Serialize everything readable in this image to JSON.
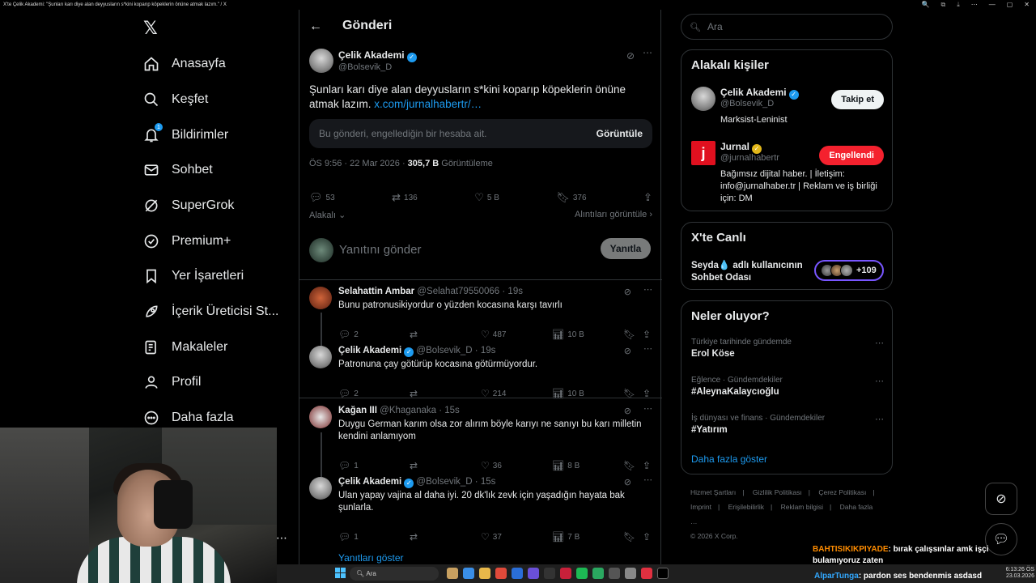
{
  "window": {
    "title": "X'te Çelik Akademi: \"Şunları karı diye alan deyyusların s*kini koparıp köpeklerin önüne atmak lazım.\" / X"
  },
  "nav": {
    "items": [
      {
        "label": "Anasayfa",
        "icon": "home-icon"
      },
      {
        "label": "Keşfet",
        "icon": "search-icon"
      },
      {
        "label": "Bildirimler",
        "icon": "bell-icon",
        "badge": "1"
      },
      {
        "label": "Sohbet",
        "icon": "mail-icon"
      },
      {
        "label": "SuperGrok",
        "icon": "grok-icon"
      },
      {
        "label": "Premium+",
        "icon": "verified-icon"
      },
      {
        "label": "Yer İşaretleri",
        "icon": "bookmark-icon"
      },
      {
        "label": "İçerik Üreticisi St...",
        "icon": "rocket-icon"
      },
      {
        "label": "Makaleler",
        "icon": "article-icon"
      },
      {
        "label": "Profil",
        "icon": "person-icon"
      },
      {
        "label": "Daha fazla",
        "icon": "more-circle-icon"
      }
    ]
  },
  "header": {
    "title": "Gönderi"
  },
  "post": {
    "author": "Çelik Akademi",
    "handle": "@Bolsevik_D",
    "text": "Şunları karı diye alan deyyusların s*kini koparıp köpeklerin önüne atmak lazım.",
    "link": "x.com/jurnalhabertr/…",
    "blocked_notice": "Bu gönderi, engellediğin bir hesaba ait.",
    "view_label": "Görüntüle",
    "time": "ÖS 9:56 · 22 Mar 2026 · ",
    "views": "305,7 B",
    "views_label": " Görüntüleme",
    "replies": "53",
    "reposts": "136",
    "likes": "5 B",
    "bookmarks": "376",
    "related_label": "Alakalı",
    "interactions_label": "Alıntıları görüntüle",
    "reply_placeholder": "Yanıtını gönder",
    "reply_button": "Yanıtla"
  },
  "replies": [
    {
      "name": "Selahattin Ambar",
      "handle": "@Selahat79550066 · 19s",
      "text": "Bunu patronusikiyordur o yüzden kocasına karşı tavırlı",
      "replies": "2",
      "likes": "487",
      "views": "10 B",
      "verified": false
    },
    {
      "name": "Çelik Akademi",
      "handle": "@Bolsevik_D · 19s",
      "text": "Patronuna çay götürüp kocasına götürmüyordur.",
      "replies": "2",
      "likes": "214",
      "views": "10 B",
      "verified": true
    },
    {
      "name": "Kağan III",
      "handle": "@Khaganaka · 15s",
      "text": "Duygu German karım olsa zor alırım böyle karıyı ne sanıyı bu karı milletin kendini anlamıyom",
      "replies": "1",
      "likes": "36",
      "views": "8 B",
      "verified": false
    },
    {
      "name": "Çelik Akademi",
      "handle": "@Bolsevik_D · 15s",
      "text": "Ulan yapay vajina al daha iyi. 20 dk'lık zevk için yaşadığın hayata bak şunlarla.",
      "replies": "1",
      "likes": "37",
      "views": "7 B",
      "verified": true
    }
  ],
  "show_replies": "Yanıtları göster",
  "search": {
    "placeholder": "Ara"
  },
  "related_people": {
    "title": "Alakalı kişiler",
    "people": [
      {
        "name": "Çelik Akademi",
        "handle": "@Bolsevik_D",
        "bio": "Marksist-Leninist",
        "button": "Takip et"
      },
      {
        "name": "Jurnal",
        "handle": "@jurnalhabertr",
        "bio": "Bağımsız dijital haber. | İletişim: info@jurnalhaber.tr | Reklam ve iş birliği için: DM",
        "button": "Engellendi",
        "logo_letter": "j"
      }
    ]
  },
  "live": {
    "title": "X'te Canlı",
    "text_line1": "Seyda💧 adlı kullanıcının",
    "text_line2": "Sohbet Odası",
    "count": "+109"
  },
  "trends": {
    "title": "Neler oluyor?",
    "items": [
      {
        "context": "Türkiye tarihinde gündemde",
        "topic": "Erol Köse"
      },
      {
        "context": "Eğlence · Gündemdekiler",
        "topic": "#AleynaKalaycıoğlu"
      },
      {
        "context": "İş dünyası ve finans · Gündemdekiler",
        "topic": "#Yatırım"
      }
    ],
    "show_more": "Daha fazla göster"
  },
  "footer": {
    "links": [
      "Hizmet Şartları",
      "|",
      "Gizlilik Politikası",
      "|",
      "Çerez Politikası",
      "|",
      "Imprint",
      "|",
      "Erişilebilirlik",
      "|",
      "Reklam bilgisi",
      "|",
      "Daha fazla …"
    ],
    "copyright": "© 2026 X Corp."
  },
  "chat": {
    "user1": "BAHTISIKIKPIYADE",
    "msg1": ": bırak çalışsınlar amk işçi bulamıyoruz zaten",
    "user2": "AlparTunga",
    "msg2": ": pardon ses bendenmis asdasd"
  },
  "taskbar": {
    "search_placeholder": "Ara",
    "time": "6:13:26 ÖS",
    "date": "23.03.2026"
  },
  "colors": {
    "accent": "#1d9bf0",
    "blocked": "#f4212e",
    "live": "#7856ff"
  }
}
